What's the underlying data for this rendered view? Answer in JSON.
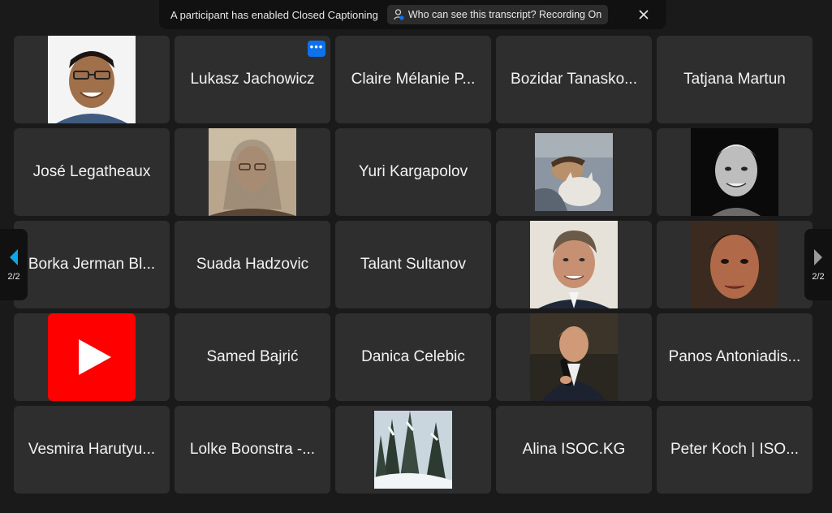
{
  "banner": {
    "text": "A participant has enabled Closed Captioning",
    "pill_label": "Who can see this transcript? Recording On"
  },
  "pager": {
    "left_label": "2/2",
    "right_label": "2/2"
  },
  "colors": {
    "accent": "#0e72ed",
    "youtube_red": "#ff0000"
  },
  "tiles": [
    {
      "name": "",
      "has_video": true,
      "icon": "participant-video"
    },
    {
      "name": "Lukasz Jachowicz"
    },
    {
      "name": "Claire  Mélanie P..."
    },
    {
      "name": "Bozidar Tanasko..."
    },
    {
      "name": "Tatjana Martun"
    },
    {
      "name": "José Legatheaux"
    },
    {
      "name": "",
      "has_video": true,
      "icon": "participant-video"
    },
    {
      "name": "Yuri Kargapolov"
    },
    {
      "name": "",
      "has_video": true,
      "icon": "participant-video"
    },
    {
      "name": "",
      "has_video": true,
      "icon": "participant-video"
    },
    {
      "name": "Borka Jerman Bl..."
    },
    {
      "name": "Suada Hadzovic"
    },
    {
      "name": "Talant Sultanov"
    },
    {
      "name": "",
      "has_video": true,
      "icon": "participant-video"
    },
    {
      "name": "",
      "has_video": true,
      "icon": "participant-video"
    },
    {
      "name": "",
      "has_video": true,
      "icon": "youtube-play-icon"
    },
    {
      "name": "Samed Bajrić"
    },
    {
      "name": "Danica Celebic"
    },
    {
      "name": "",
      "has_video": true,
      "icon": "participant-video"
    },
    {
      "name": "Panos Antoniadis..."
    },
    {
      "name": "Vesmira Harutyu..."
    },
    {
      "name": "Lolke Boonstra -..."
    },
    {
      "name": "",
      "has_video": true,
      "icon": "participant-video"
    },
    {
      "name": "Alina ISOC.KG"
    },
    {
      "name": "Peter Koch | ISO..."
    }
  ]
}
